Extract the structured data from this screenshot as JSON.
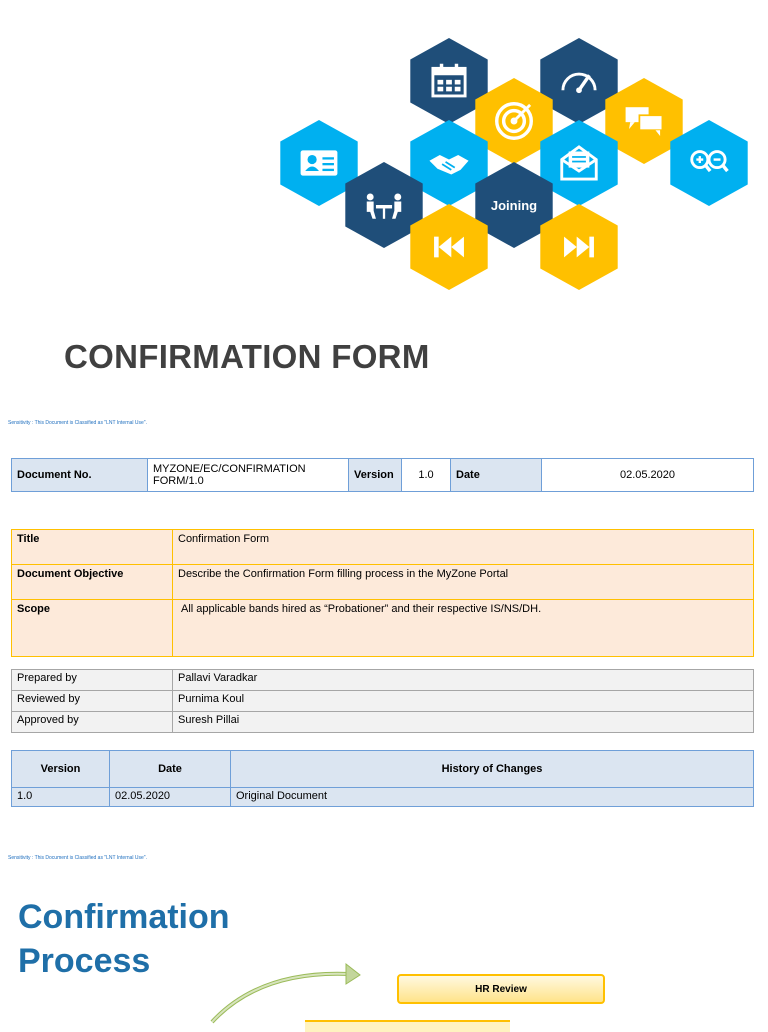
{
  "hero": {
    "joining_label": "Joining"
  },
  "title": "CONFIRMATION FORM",
  "sensitivity": "Sensitivity : This Document is Classified as \"LNT Internal Use\".",
  "doc_header": {
    "doc_no_label": "Document No.",
    "doc_no_value": "MYZONE/EC/CONFIRMATION FORM/1.0",
    "version_label": "Version",
    "version_value": "1.0",
    "date_label": "Date",
    "date_value": "02.05.2020"
  },
  "info": {
    "title_label": "Title",
    "title_value": "Confirmation Form",
    "objective_label": "Document Objective",
    "objective_value": "Describe the Confirmation Form filling process in the MyZone Portal",
    "scope_label": "Scope",
    "scope_value": "All applicable bands hired as “Probationer” and their respective IS/NS/DH."
  },
  "approvals": [
    {
      "label": "Prepared by",
      "value": "Pallavi Varadkar"
    },
    {
      "label": "Reviewed by",
      "value": "Purnima Koul"
    },
    {
      "label": "Approved by",
      "value": "Suresh Pillai"
    }
  ],
  "history": {
    "headers": [
      "Version",
      "Date",
      "History of Changes"
    ],
    "rows": [
      [
        "1.0",
        "02.05.2020",
        "Original Document"
      ]
    ]
  },
  "section_title_line1": "Confirmation",
  "section_title_line2": "Process",
  "hr_review": "HR Review",
  "colors": {
    "navy": "#1f4e79",
    "gold": "#ffc000",
    "sky": "#00b0f0",
    "title": "#404040",
    "section": "#1f6fa8"
  }
}
